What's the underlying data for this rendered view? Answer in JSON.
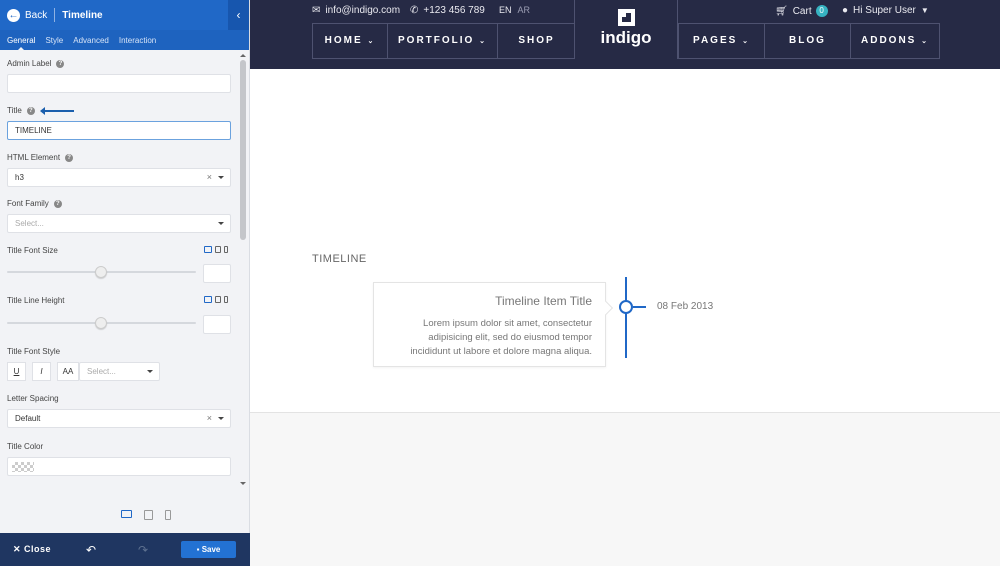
{
  "panel": {
    "back_label": "Back",
    "title": "Timeline",
    "collapse_icon": "chevron-left-icon",
    "tabs": [
      "General",
      "Style",
      "Advanced",
      "Interaction"
    ],
    "active_tab": "General",
    "fields": {
      "admin_label": {
        "label": "Admin Label",
        "value": ""
      },
      "title": {
        "label": "Title",
        "value": "TIMELINE"
      },
      "html_element": {
        "label": "HTML Element",
        "value": "h3"
      },
      "font_family": {
        "label": "Font Family",
        "placeholder": "Select..."
      },
      "title_font_size": {
        "label": "Title Font Size"
      },
      "title_line_height": {
        "label": "Title Line Height"
      },
      "title_font_style": {
        "label": "Title Font Style",
        "buttons": [
          "U",
          "I",
          "AA"
        ],
        "placeholder": "Select..."
      },
      "letter_spacing": {
        "label": "Letter Spacing",
        "value": "Default"
      },
      "title_color": {
        "label": "Title Color"
      }
    },
    "footer": {
      "close_label": "Close",
      "save_label": "Save"
    },
    "colors": {
      "accent": "#2068c7",
      "footer": "#1f3661"
    }
  },
  "site": {
    "email": "info@indigo.com",
    "phone": "+123 456 789",
    "lang": [
      "EN",
      "AR"
    ],
    "cart_label": "Cart",
    "cart_count": "0",
    "user_label": "Hi Super User",
    "logo_text": "indigo",
    "menu_left": [
      "HOME",
      "PORTFOLIO",
      "SHOP"
    ],
    "menu_right": [
      "PAGES",
      "BLOG",
      "ADDONS"
    ],
    "colors": {
      "nav": "#262a45",
      "badge": "#36b3c2"
    }
  },
  "timeline": {
    "heading": "TIMELINE",
    "item_title": "Timeline Item Title",
    "item_text": "Lorem ipsum dolor sit amet, consectetur adipisicing elit, sed do eiusmod tempor incididunt ut labore et dolore magna aliqua.",
    "date": "08 Feb 2013"
  }
}
